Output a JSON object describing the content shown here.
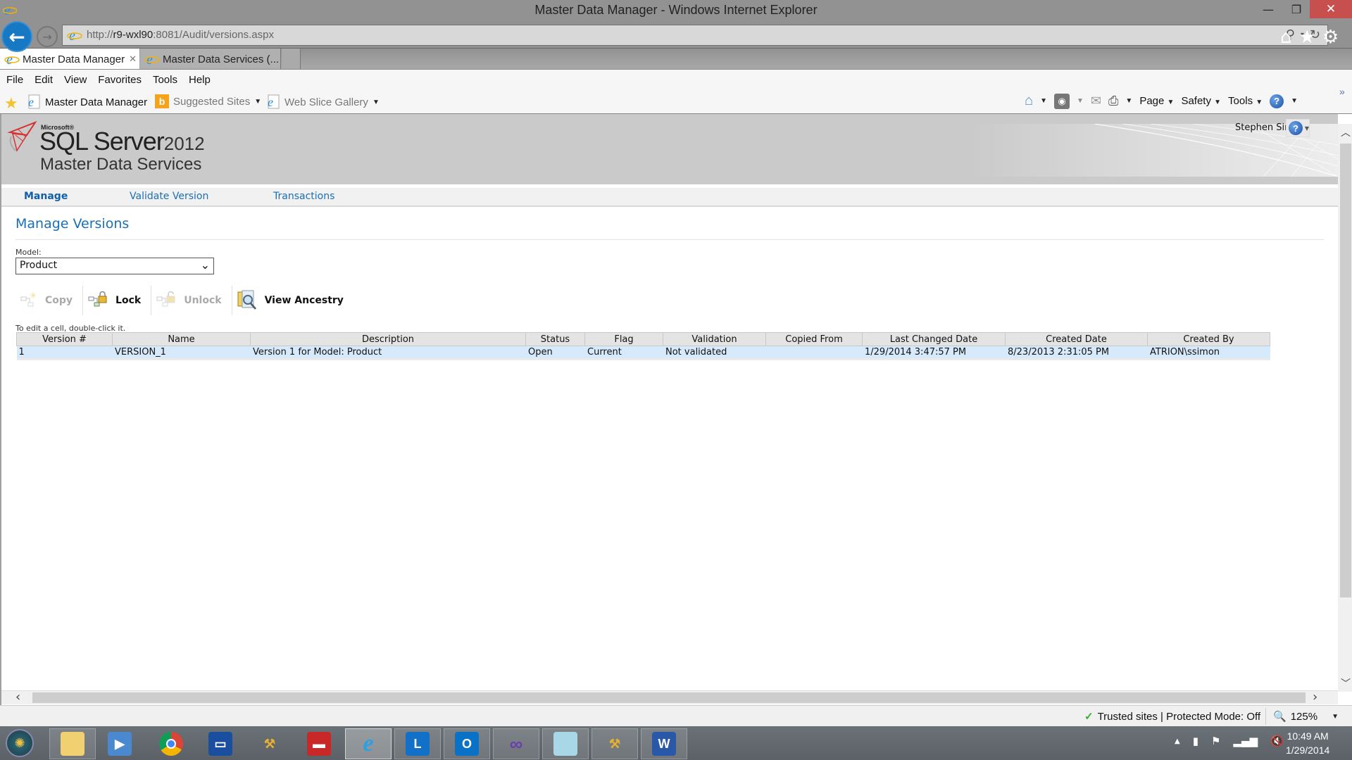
{
  "window": {
    "title": "Master Data Manager - Windows Internet Explorer",
    "minimize": "—",
    "maximize": "❐",
    "close": "✕"
  },
  "browser": {
    "url_prefix": "http://",
    "url_host": "r9-wxl90",
    "url_rest": ":8081/Audit/versions.aspx",
    "tabs": [
      {
        "label": "Master Data Manager",
        "active": true
      },
      {
        "label": "Master Data Services (...",
        "active": false
      }
    ],
    "menu": [
      "File",
      "Edit",
      "View",
      "Favorites",
      "Tools",
      "Help"
    ],
    "favorites": [
      {
        "label": "Master Data Manager",
        "icon": "ie-page-icon"
      },
      {
        "label": "Suggested Sites",
        "icon": "bing-icon",
        "dropdown": true
      },
      {
        "label": "Web Slice Gallery",
        "icon": "ie-page-icon",
        "dropdown": true
      }
    ],
    "command_bar": [
      "Page",
      "Safety",
      "Tools"
    ],
    "chevron": "»"
  },
  "app": {
    "brand_microsoft": "Microsoft®",
    "brand_sql": "SQL Server",
    "brand_year": "2012",
    "brand_product": "Master Data Services",
    "user_name": "Stephen Simon",
    "nav": [
      {
        "label": "Manage",
        "active": true
      },
      {
        "label": "Validate Version",
        "active": false
      },
      {
        "label": "Transactions",
        "active": false
      }
    ],
    "page_title": "Manage Versions",
    "model_label": "Model:",
    "model_value": "Product",
    "toolbar": [
      {
        "label": "Copy",
        "enabled": false
      },
      {
        "label": "Lock",
        "enabled": true
      },
      {
        "label": "Unlock",
        "enabled": false
      },
      {
        "label": "View Ancestry",
        "enabled": true
      }
    ],
    "hint": "To edit a cell, double-click it.",
    "grid": {
      "columns": [
        "Version #",
        "Name",
        "Description",
        "Status",
        "Flag",
        "Validation",
        "Copied From",
        "Last Changed Date",
        "Created Date",
        "Created By"
      ],
      "rows": [
        [
          "1",
          "VERSION_1",
          "Version 1 for Model: Product",
          "Open",
          "Current",
          "Not validated",
          "",
          "1/29/2014 3:47:57 PM",
          "8/23/2013 2:31:05 PM",
          "ATRION\\ssimon"
        ]
      ]
    }
  },
  "status": {
    "zone": "Trusted sites | Protected Mode: Off",
    "zoom": "125%"
  },
  "taskbar": {
    "apps": [
      "File Explorer",
      "Windows Media Player",
      "Chrome",
      "Remote Desktop",
      "MDS Configuration",
      "Toolbox",
      "Internet Explorer",
      "Lync",
      "Outlook",
      "Visual Studio",
      "Notepad",
      "MDS Configuration",
      "Word"
    ],
    "time": "10:49 AM",
    "date": "1/29/2014"
  },
  "colors": {
    "accent": "#1a6fb6",
    "selected_row": "#d6eafb",
    "close_button": "#c7504f"
  }
}
